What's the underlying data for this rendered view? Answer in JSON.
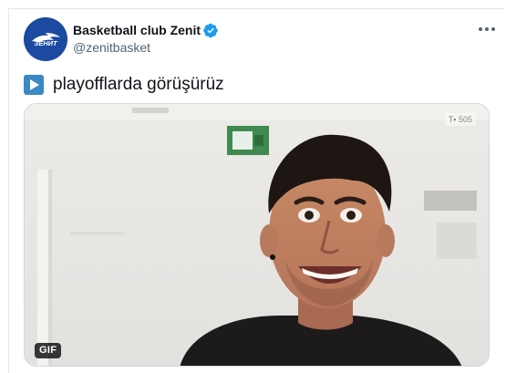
{
  "author": {
    "display_name": "Basketball club Zenit",
    "handle": "@zenitbasket",
    "avatar_icon": "zenit-logo",
    "verified": true,
    "verified_color": "#1d9bf0",
    "avatar_color": "#1b4aa0"
  },
  "tweet": {
    "emoji_icon": "play-button-emoji",
    "text": "playofflarda görüşürüz"
  },
  "media": {
    "badge_label": "GIF",
    "watermark": "T▪ 505"
  },
  "menu": {
    "icon": "more-options-icon"
  }
}
